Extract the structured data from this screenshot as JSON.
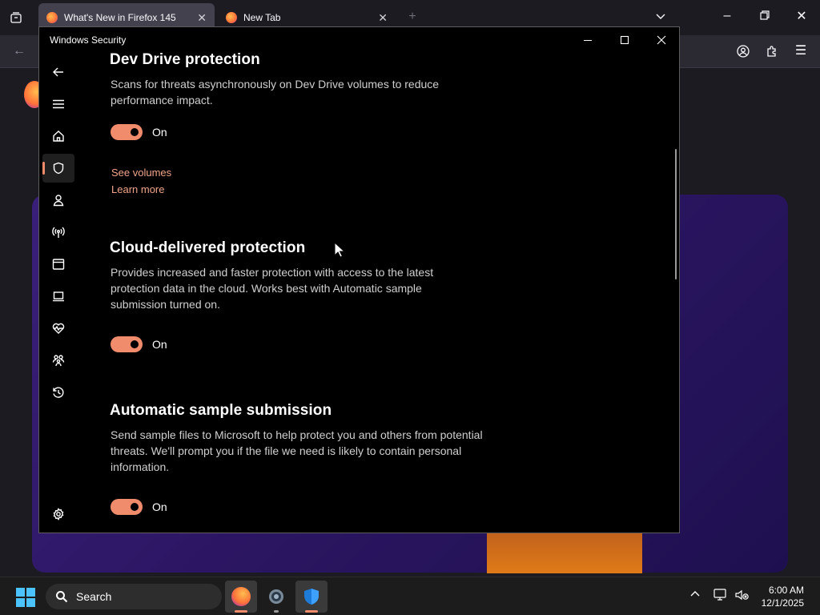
{
  "firefox": {
    "tabs": [
      {
        "title": "What's New in Firefox 145",
        "active": true
      },
      {
        "title": "New Tab",
        "active": false
      }
    ]
  },
  "window": {
    "title": "Windows Security"
  },
  "nav": {
    "items": [
      {
        "icon": "back-arrow-icon"
      },
      {
        "icon": "menu-icon"
      },
      {
        "icon": "home-icon"
      },
      {
        "icon": "shield-icon",
        "selected": true
      },
      {
        "icon": "person-icon"
      },
      {
        "icon": "network-icon"
      },
      {
        "icon": "app-browser-icon"
      },
      {
        "icon": "laptop-icon"
      },
      {
        "icon": "heart-pulse-icon"
      },
      {
        "icon": "family-icon"
      },
      {
        "icon": "history-icon"
      },
      {
        "icon": "settings-icon"
      }
    ]
  },
  "sections": {
    "dev_drive": {
      "title": "Dev Drive protection",
      "description": "Scans for threats asynchronously on Dev Drive volumes to reduce performance impact.",
      "toggle_label": "On",
      "links": [
        "See volumes",
        "Learn more"
      ]
    },
    "cloud": {
      "title": "Cloud-delivered protection",
      "description": "Provides increased and faster protection with access to the latest protection data in the cloud. Works best with Automatic sample submission turned on.",
      "toggle_label": "On"
    },
    "sample": {
      "title": "Automatic sample submission",
      "description": "Send sample files to Microsoft to help protect you and others from potential threats. We'll prompt you if the file we need is likely to contain personal information.",
      "toggle_label": "On"
    }
  },
  "taskbar": {
    "search_label": "Search",
    "time": "6:00 AM",
    "date": "12/1/2025"
  },
  "colors": {
    "accent": "#f08c6c",
    "window_bg": "#000000",
    "firefox_card": "#2a1560"
  }
}
